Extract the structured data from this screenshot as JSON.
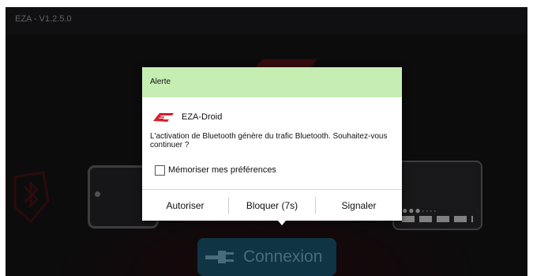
{
  "titlebar": {
    "title": "EZA - V1.2.5.0"
  },
  "dialog": {
    "header": "Alerte",
    "app_name": "EZA-Droid",
    "message": "L'activation de Bluetooth génère du trafic Bluetooth. Souhaitez-vous continuer ?",
    "remember_label": "Mémoriser mes préférences",
    "remember_checked": false,
    "buttons": {
      "allow": "Autoriser",
      "block": "Bloquer (7s)",
      "report": "Signaler"
    }
  },
  "main": {
    "connect_label": "Connexion"
  },
  "colors": {
    "header_bg": "#c6eeb3",
    "brand_red": "#d4212b",
    "connect_bg": "#1b5a76"
  }
}
